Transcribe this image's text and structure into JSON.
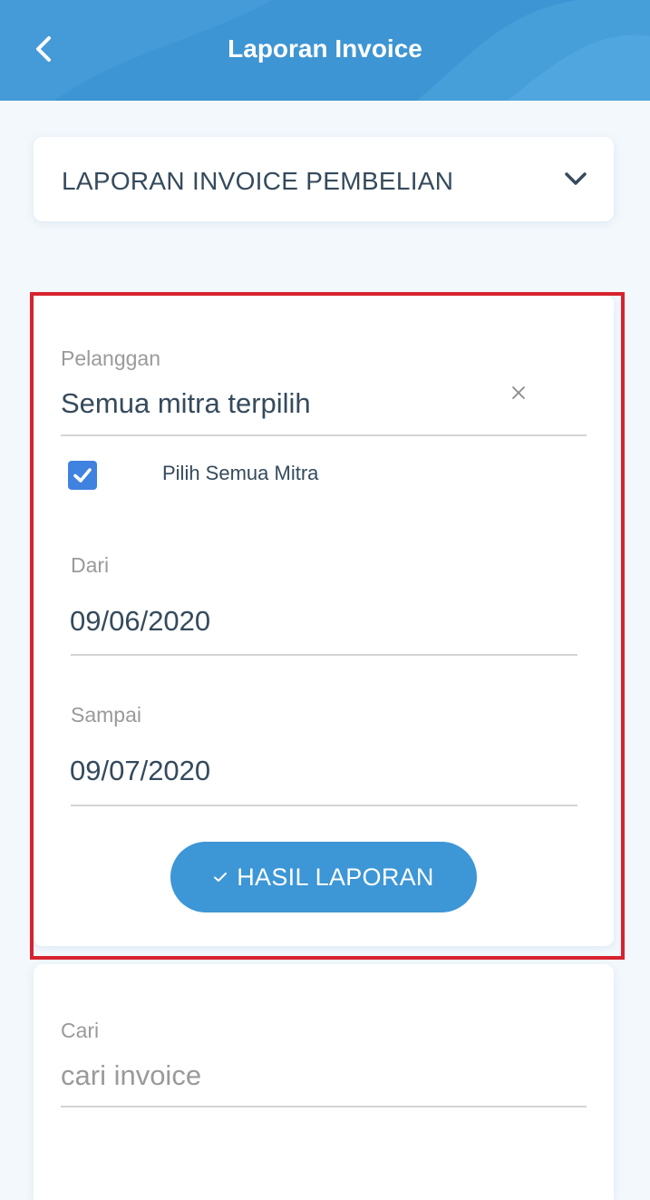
{
  "header": {
    "title": "Laporan Invoice",
    "back_icon": "chevron-left-icon",
    "color": "#3e95d3"
  },
  "report_type": {
    "selected": "LAPORAN INVOICE PEMBELIAN",
    "icon": "chevron-down-icon"
  },
  "form": {
    "customer": {
      "label": "Pelanggan",
      "value": "Semua mitra terpilih",
      "clear_icon": "close-icon"
    },
    "select_all": {
      "label": "Pilih Semua Mitra",
      "checked": true,
      "color": "#3f82e0"
    },
    "date_from": {
      "label": "Dari",
      "value": "09/06/2020"
    },
    "date_to": {
      "label": "Sampai",
      "value": "09/07/2020"
    },
    "submit": {
      "label": "HASIL LAPORAN",
      "icon": "check-icon",
      "color": "#3d96d6"
    },
    "highlight_color": "#d7232f"
  },
  "search": {
    "label": "Cari",
    "placeholder": "cari invoice"
  }
}
